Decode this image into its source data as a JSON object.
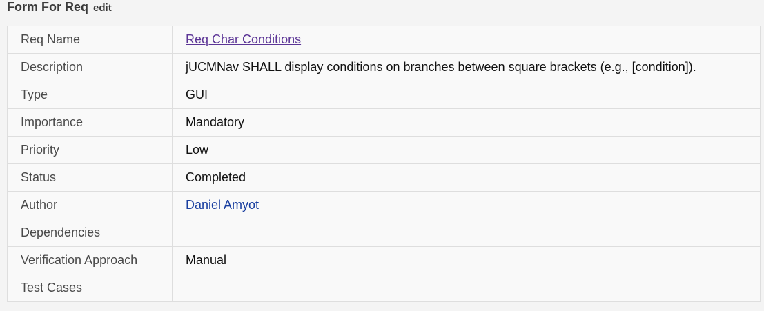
{
  "header": {
    "title": "Form For Req",
    "edit_label": "edit"
  },
  "fields": [
    {
      "label": "Req Name",
      "value": "Req Char Conditions"
    },
    {
      "label": "Description",
      "value": "jUCMNav SHALL display conditions on branches between square brackets (e.g., [condition])."
    },
    {
      "label": "Type",
      "value": "GUI"
    },
    {
      "label": "Importance",
      "value": "Mandatory"
    },
    {
      "label": "Priority",
      "value": "Low"
    },
    {
      "label": "Status",
      "value": "Completed"
    },
    {
      "label": "Author",
      "value": "Daniel Amyot"
    },
    {
      "label": "Dependencies",
      "value": ""
    },
    {
      "label": "Verification Approach",
      "value": "Manual"
    },
    {
      "label": "Test Cases",
      "value": ""
    }
  ],
  "colors": {
    "visited_link": "#5c3596",
    "author_link": "#1a3fa0",
    "border": "#dedede",
    "background": "#f4f4f4"
  }
}
